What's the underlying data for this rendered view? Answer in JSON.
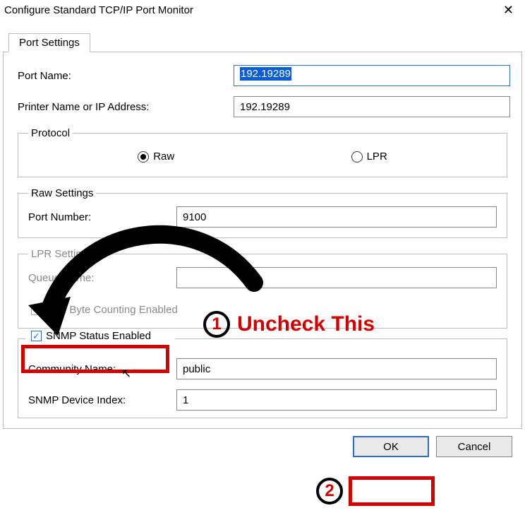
{
  "window": {
    "title": "Configure Standard TCP/IP Port Monitor",
    "close_glyph": "✕"
  },
  "tab": {
    "label": "Port Settings"
  },
  "fields": {
    "port_name_label": "Port Name:",
    "port_name_value": "192.19289",
    "printer_addr_label": "Printer Name or IP Address:",
    "printer_addr_value": "192.19289"
  },
  "protocol": {
    "legend": "Protocol",
    "raw_label": "Raw",
    "lpr_label": "LPR",
    "selected": "raw"
  },
  "raw_settings": {
    "legend": "Raw Settings",
    "port_number_label": "Port Number:",
    "port_number_value": "9100"
  },
  "lpr_settings": {
    "legend": "LPR Settings",
    "queue_name_label": "Queue Name:",
    "queue_name_value": "",
    "byte_counting_label": "LPR Byte Counting Enabled"
  },
  "snmp": {
    "checkbox_label": "SNMP Status Enabled",
    "community_label": "Community Name:",
    "community_value": "public",
    "device_index_label": "SNMP Device Index:",
    "device_index_value": "1"
  },
  "buttons": {
    "ok": "OK",
    "cancel": "Cancel"
  },
  "annotations": {
    "step1_num": "1",
    "step1_text": "Uncheck This",
    "step2_num": "2"
  }
}
